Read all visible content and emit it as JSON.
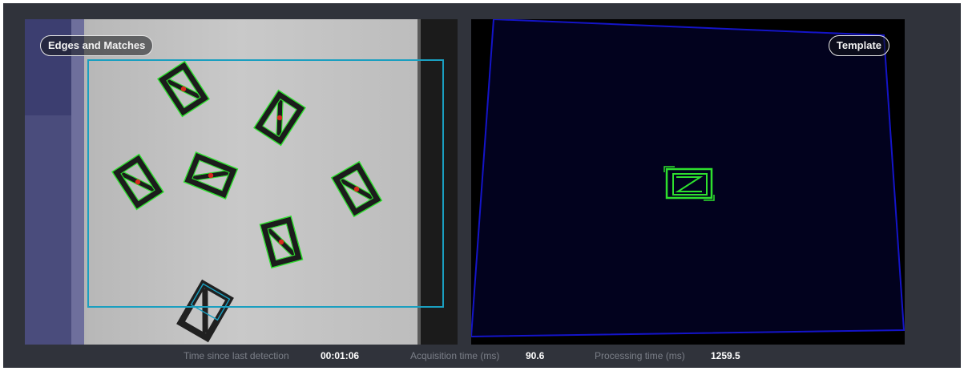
{
  "panels": {
    "left": {
      "title": "Edges and Matches"
    },
    "right": {
      "title": "Template"
    }
  },
  "status": {
    "time_label": "Time since last detection",
    "time_value": "00:01:06",
    "acq_label": "Acquisition time (ms)",
    "acq_value": "90.6",
    "proc_label": "Processing time (ms)",
    "proc_value": "1259.5"
  },
  "colors": {
    "background": "#30333b",
    "roi": "#1a9fc0",
    "edge_match": "#2ee02e",
    "match_center": "#d8281c",
    "template_bg": "#02021e",
    "template_border": "#1414c8"
  },
  "icons": {
    "part": "zigzag-part-icon"
  }
}
